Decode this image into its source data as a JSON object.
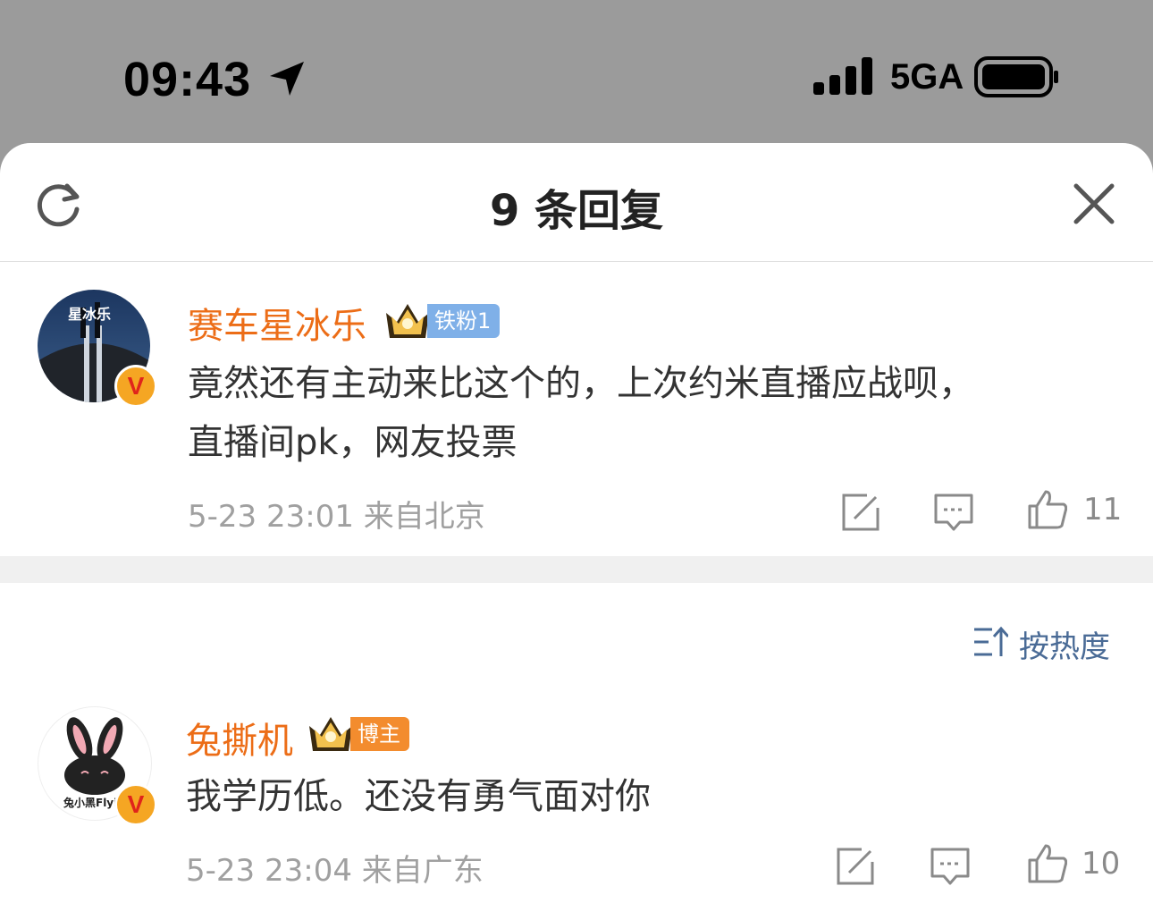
{
  "status_bar": {
    "time": "09:43",
    "network": "5GA"
  },
  "sheet": {
    "title": "9 条回复"
  },
  "comments": [
    {
      "username": "赛车星冰乐",
      "badge": "铁粉1",
      "avatar_text": "星冰乐",
      "text_line1": "竟然还有主动来比这个的，上次约米直播应战呗，",
      "text_line2": "直播间pk，网友投票",
      "meta": "5-23 23:01 来自北京",
      "likes": "11"
    },
    {
      "username": "兔撕机",
      "badge": "博主",
      "avatar_text": "兔小黑Flyi",
      "text_line1": "我学历低。还没有勇气面对你",
      "meta": "5-23 23:04 来自广东",
      "likes": "10"
    }
  ],
  "sort": {
    "label": "按热度"
  },
  "verify_symbol": "V",
  "colors": {
    "username": "#ec6d17",
    "link": "#4a6b96",
    "badge_blue": "#7fb0e8",
    "badge_orange": "#f38c2e"
  }
}
